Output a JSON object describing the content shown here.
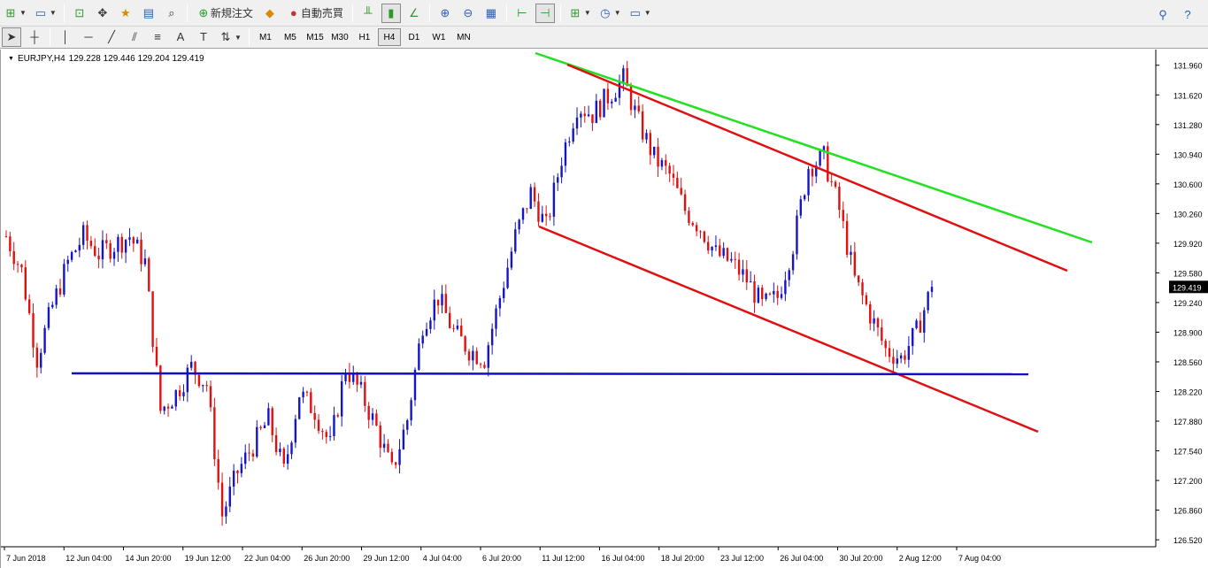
{
  "toolbar1": {
    "new_order_label": "新規注文",
    "auto_trading_label": "自動売買"
  },
  "toolbar2": {
    "timeframes": [
      "M1",
      "M5",
      "M15",
      "M30",
      "H1",
      "H4",
      "D1",
      "W1",
      "MN"
    ],
    "active_timeframe": "H4",
    "text_tool_label": "A"
  },
  "chart": {
    "symbol": "EURJPY,H4",
    "ohlc": "129.228 129.446 129.204 129.419",
    "current_price": "129.419",
    "colors": {
      "up_candle": "#1515c8",
      "down_candle": "#e01010",
      "resistance_line": "#22e022",
      "channel_line": "#e01010",
      "support_line": "#1010c0",
      "price_tag_bg": "#000000"
    }
  },
  "chart_data": {
    "type": "line",
    "title": "EURJPY,H4",
    "y_ticks": [
      "131.960",
      "131.620",
      "131.280",
      "130.940",
      "130.600",
      "130.260",
      "129.920",
      "129.580",
      "129.240",
      "128.900",
      "128.560",
      "128.220",
      "127.880",
      "127.540",
      "127.200",
      "126.860",
      "126.520"
    ],
    "x_ticks": [
      "7 Jun 2018",
      "12 Jun 04:00",
      "14 Jun 20:00",
      "19 Jun 12:00",
      "22 Jun 04:00",
      "26 Jun 20:00",
      "29 Jun 12:00",
      "4 Jul 04:00",
      "6 Jul 20:00",
      "11 Jul 12:00",
      "16 Jul 04:00",
      "18 Jul 20:00",
      "23 Jul 12:00",
      "26 Jul 04:00",
      "30 Jul 20:00",
      "2 Aug 12:00",
      "7 Aug 04:00"
    ],
    "ylim": [
      126.44,
      132.14
    ],
    "series": [
      {
        "values": [
          130.0,
          129.6,
          128.6,
          129.2,
          129.7,
          130.0,
          129.8,
          129.9,
          130.0,
          129.7,
          128.0,
          128.2,
          128.5,
          128.3,
          126.8,
          127.3,
          127.6,
          127.9,
          127.3,
          128.2,
          128.0,
          127.6,
          128.5,
          128.2,
          127.8,
          127.3,
          127.9,
          129.0,
          129.3,
          128.9,
          128.7,
          128.6,
          129.3,
          130.0,
          130.5,
          130.1,
          130.9,
          131.5,
          131.4,
          131.6,
          131.8,
          131.3,
          130.9,
          130.7,
          130.3,
          130.1,
          129.8,
          129.7,
          129.5,
          129.2,
          129.3,
          129.9,
          130.8,
          130.9,
          130.3,
          129.5,
          129.1,
          128.7,
          128.6,
          128.9,
          129.42
        ]
      }
    ],
    "trendlines": [
      {
        "name": "green resistance",
        "points": [
          [
            0,
            132.28
          ],
          [
            86,
            130.06
          ]
        ]
      },
      {
        "name": "red channel upper",
        "points": [
          [
            23,
            132.1
          ],
          [
            83,
            129.8
          ]
        ]
      },
      {
        "name": "red channel lower",
        "points": [
          [
            10,
            130.26
          ],
          [
            82,
            127.84
          ]
        ]
      },
      {
        "name": "blue support",
        "points": [
          [
            -60,
            128.54
          ],
          [
            75,
            128.54
          ]
        ]
      }
    ]
  }
}
